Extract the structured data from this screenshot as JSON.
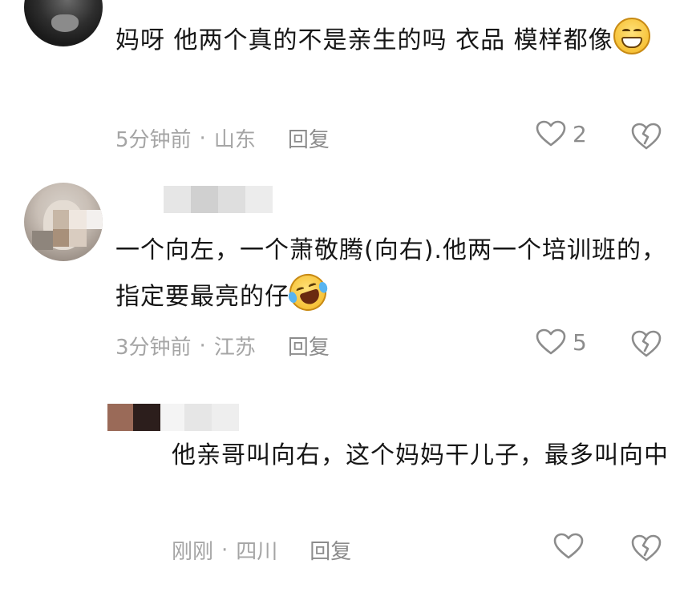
{
  "comments": [
    {
      "text": "妈呀 他两个真的不是亲生的吗 衣品 模样都像",
      "time": "5分钟前",
      "location": "山东",
      "reply_label": "回复",
      "like_count": "2"
    },
    {
      "text": "一个向左，一个萧敬腾(向右).他两一个培训班的，指定要最亮的仔",
      "time": "3分钟前",
      "location": "江苏",
      "reply_label": "回复",
      "like_count": "5"
    },
    {
      "text": "他亲哥叫向右，这个妈妈干儿子，最多叫向中",
      "time": "刚刚",
      "location": "四川",
      "reply_label": "回复",
      "like_count": ""
    }
  ],
  "separator": "·",
  "colors": {
    "text": "#161616",
    "meta": "#a5a5a5",
    "icon": "#8c8c8c"
  }
}
